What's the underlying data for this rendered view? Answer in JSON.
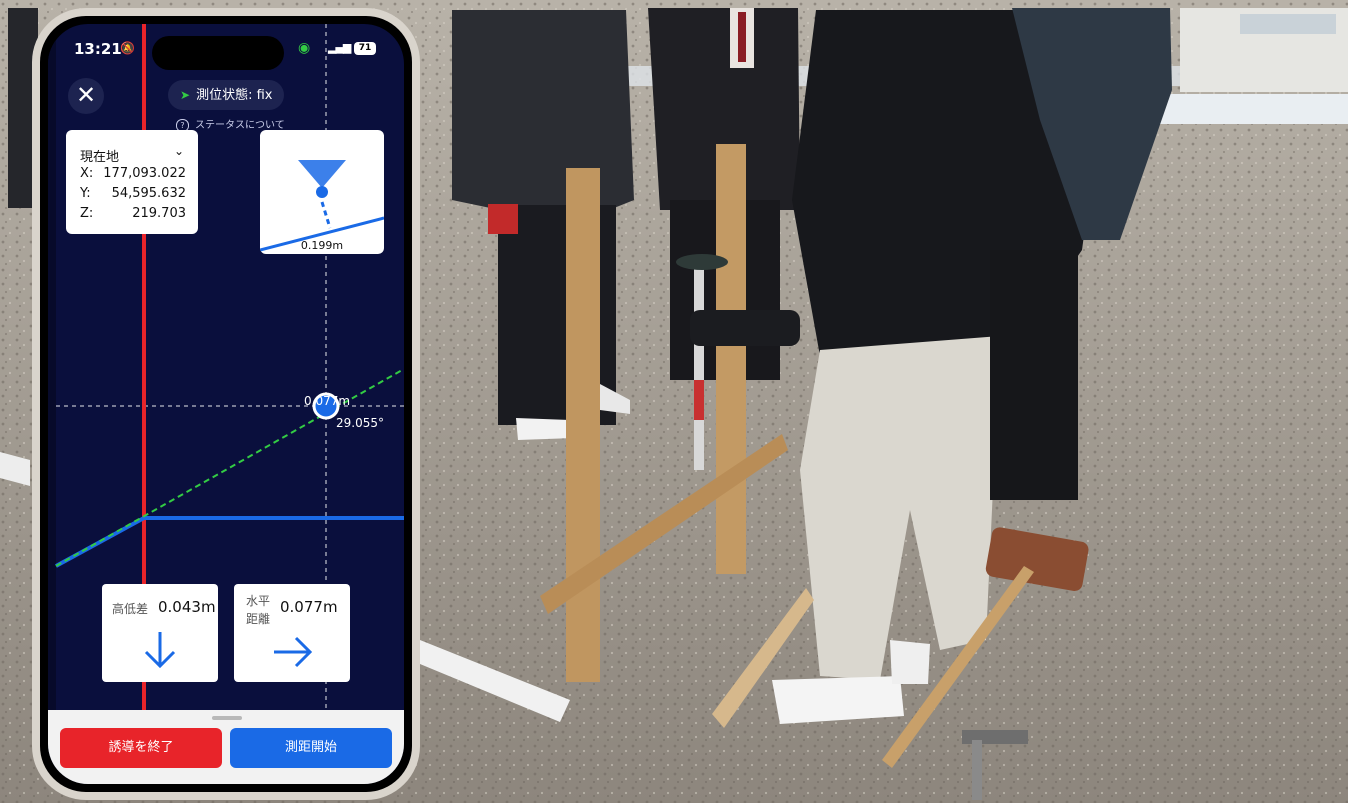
{
  "status_bar": {
    "time": "13:21",
    "battery": "71"
  },
  "header": {
    "close_symbol": "✕",
    "gnss_status": "測位状態: fix",
    "status_help_link": "ステータスについて"
  },
  "current_position": {
    "title": "現在地",
    "x_label": "X:",
    "x_value": "177,093.022",
    "y_label": "Y:",
    "y_value": "54,595.632",
    "z_label": "Z:",
    "z_value": "219.703"
  },
  "level_indicator": {
    "value": "0.199m"
  },
  "map_view": {
    "distance_label": "0.077m",
    "angle_label": "29.055°"
  },
  "guidance": {
    "height_diff_label": "高低差",
    "height_diff_value": "0.043m",
    "horizontal_label": "水平距離",
    "horizontal_value": "0.077m"
  },
  "actions": {
    "end_guidance": "誘導を終了",
    "start_measure": "測距開始"
  },
  "colors": {
    "screen_bg": "#0a0f3d",
    "reference_line": "#e8242a",
    "accent_blue": "#1a6ae6",
    "guide_dashed": "#33cc44",
    "gnss_fix": "#33cc44"
  }
}
